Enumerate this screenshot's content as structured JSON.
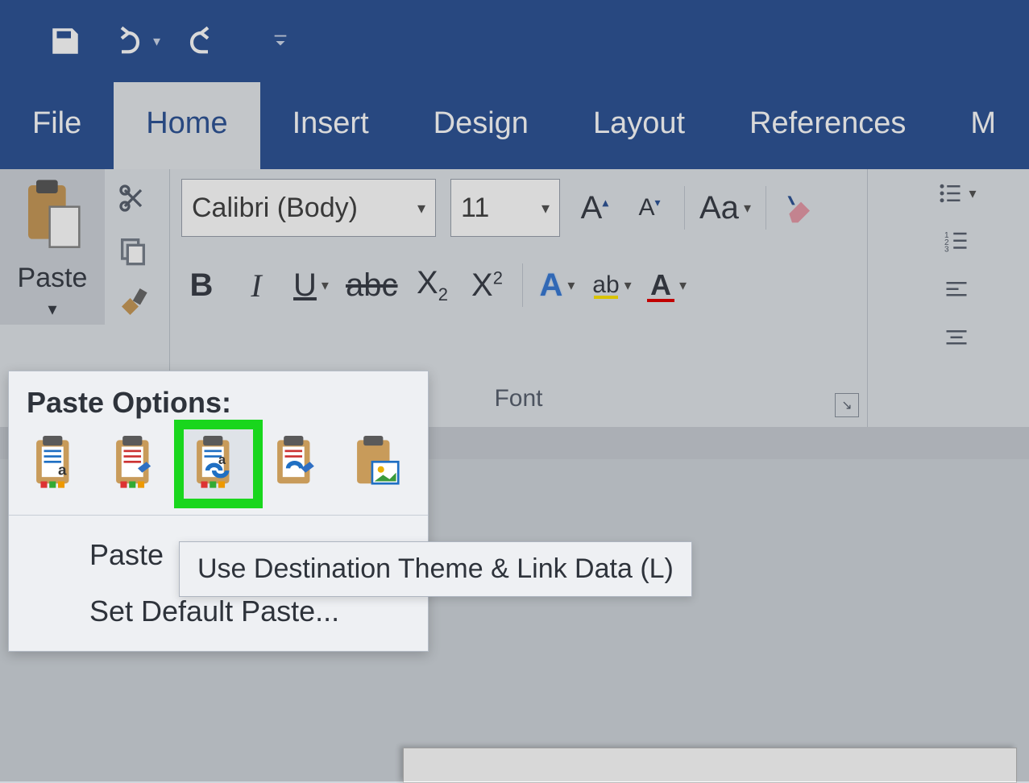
{
  "quick_access": {
    "save": "save",
    "undo": "undo",
    "redo": "redo",
    "customize": "customize"
  },
  "tabs": {
    "file": "File",
    "home": "Home",
    "insert": "Insert",
    "design": "Design",
    "layout": "Layout",
    "references": "References",
    "more": "M"
  },
  "clipboard": {
    "paste_label": "Paste"
  },
  "font": {
    "name": "Calibri (Body)",
    "size": "11",
    "group_label": "Font",
    "change_case": "Aa"
  },
  "paste_options": {
    "title": "Paste Options:",
    "paste_special": "Paste",
    "set_default": "Set Default Paste...",
    "tooltip": "Use Destination Theme & Link Data (L)"
  }
}
